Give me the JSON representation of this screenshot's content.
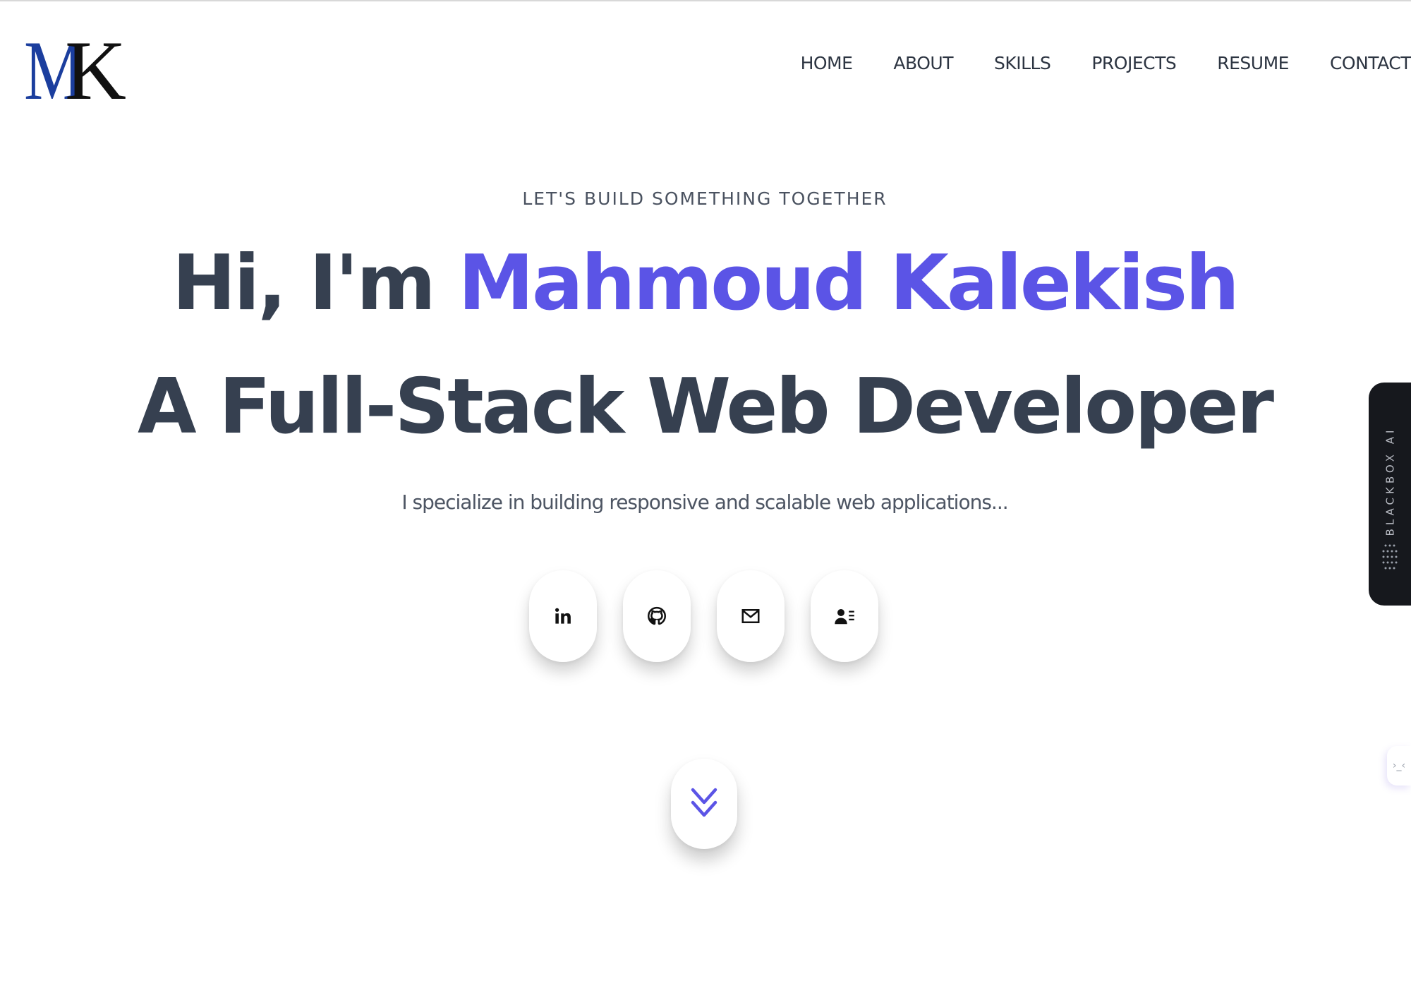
{
  "brand": {
    "logo_text": "MK",
    "colors": {
      "m": "#1b3e9e",
      "k": "#111111"
    }
  },
  "nav": {
    "items": [
      "HOME",
      "ABOUT",
      "SKILLS",
      "PROJECTS",
      "RESUME",
      "CONTACT"
    ]
  },
  "hero": {
    "eyebrow": "LET'S BUILD SOMETHING TOGETHER",
    "greeting": "Hi, I'm ",
    "name": "Mahmoud Kalekish",
    "role": "A Full-Stack Web Developer",
    "subtitle": "I specialize in building responsive and scalable web applications..."
  },
  "social": [
    {
      "icon": "linkedin-icon"
    },
    {
      "icon": "github-icon"
    },
    {
      "icon": "mail-icon"
    },
    {
      "icon": "contact-card-icon"
    }
  ],
  "scroll": {
    "icon": "double-chevron-down-icon"
  },
  "blackbox": {
    "label": "BLACKBOX AI"
  },
  "side_peek": {
    "glyph": "›_‹"
  },
  "colors": {
    "accent": "#5b54e6",
    "text": "#364050"
  }
}
